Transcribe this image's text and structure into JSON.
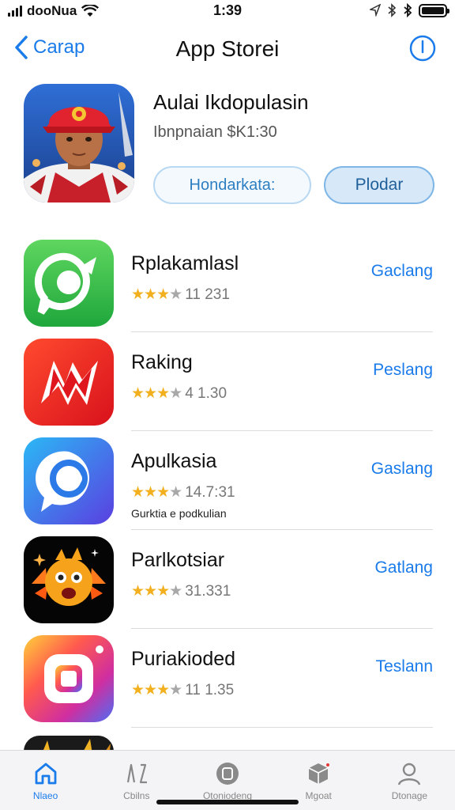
{
  "status_bar": {
    "carrier": "dooNua",
    "time": "1:39",
    "battery_level": 1.0
  },
  "nav": {
    "back_label": "Carap",
    "title": "App Storei",
    "back_icon": "chevron-left-icon",
    "info_icon": "info-icon"
  },
  "featured": {
    "title": "Aulai Ikdopulasin",
    "subtitle": "Ibnpnaian $K1:30",
    "secondary_button": "Hondarkata:",
    "primary_button": "Plodar"
  },
  "apps": [
    {
      "name": "Rplakamlasl",
      "rating": 3,
      "rating_count": "11 231",
      "action": "Gaclang",
      "icon": "chat-bubble-icon",
      "extra": ""
    },
    {
      "name": "Raking",
      "rating": 3,
      "rating_count": "4 1.30",
      "action": "Peslang",
      "icon": "bolt-logo-icon",
      "extra": ""
    },
    {
      "name": "Apulkasia",
      "rating": 3,
      "rating_count": "14.7:31",
      "action": "Gaslang",
      "icon": "messenger-icon",
      "extra": "Gurktia e podkulian"
    },
    {
      "name": "Parlkotsiar",
      "rating": 3,
      "rating_count": "31.331",
      "action": "Gatlang",
      "icon": "monster-face-icon",
      "extra": ""
    },
    {
      "name": "Puriakioded",
      "rating": 3,
      "rating_count": "11 1.35",
      "action": "Teslann",
      "icon": "camera-gradient-icon",
      "extra": ""
    }
  ],
  "tabs": [
    {
      "label": "Nlaeo",
      "icon": "home-icon",
      "active": true
    },
    {
      "label": "Cbilns",
      "icon": "apps-icon",
      "active": false
    },
    {
      "label": "Otoniodeng",
      "icon": "games-icon",
      "active": false
    },
    {
      "label": "Mgoat",
      "icon": "arcade-icon",
      "active": false
    },
    {
      "label": "Dtonage",
      "icon": "profile-icon",
      "active": false
    }
  ],
  "colors": {
    "accent": "#1a7bea",
    "star": "#f2b01e"
  }
}
